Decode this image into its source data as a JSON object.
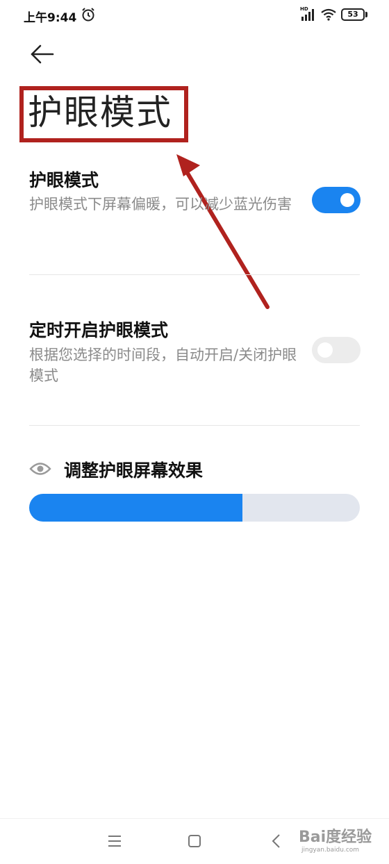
{
  "status_bar": {
    "time": "上午9:44",
    "network_label": "HD",
    "battery": "53"
  },
  "header": {
    "title": "护眼模式"
  },
  "settings": [
    {
      "title": "护眼模式",
      "description": "护眼模式下屏幕偏暖，可以减少蓝光伤害",
      "enabled": true
    },
    {
      "title": "定时开启护眼模式",
      "description": "根据您选择的时间段，自动开启/关闭护眼模式",
      "enabled": false
    }
  ],
  "adjust": {
    "title": "调整护眼屏幕效果",
    "level": 0.645
  },
  "watermark": {
    "text": "Bai度经验",
    "sub": "jingyan.baidu.com"
  },
  "colors": {
    "accent": "#1a84f0",
    "annotation": "#b0221e"
  }
}
